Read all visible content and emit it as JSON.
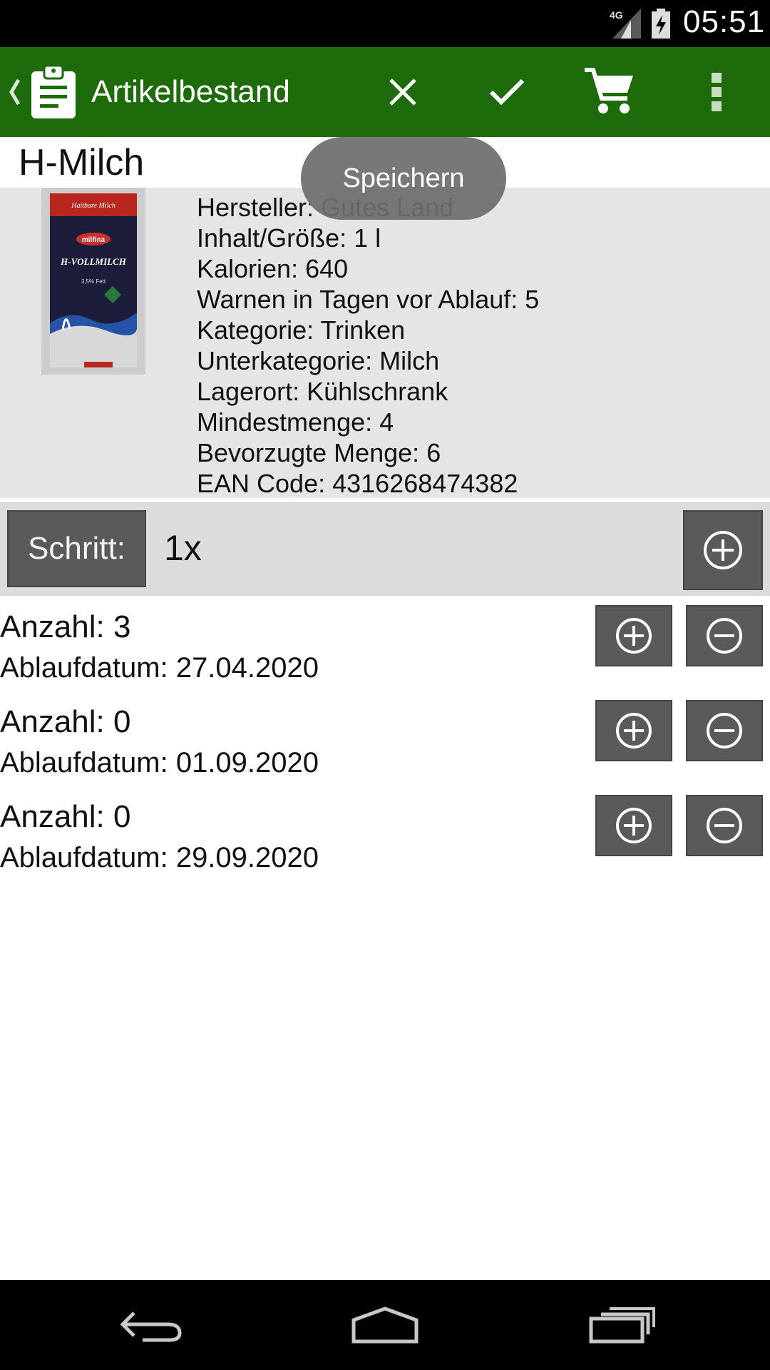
{
  "status_bar": {
    "network_label": "4G",
    "time": "05:51",
    "icons": [
      "signal-4g-icon",
      "battery-charging-icon"
    ]
  },
  "action_bar": {
    "title": "Artikelbestand",
    "background_color": "#1e6b0c",
    "icons": [
      "up-chevron-icon",
      "clipboard-icon",
      "close-icon",
      "check-icon",
      "cart-icon",
      "more-vert-icon"
    ]
  },
  "product": {
    "name": "H-Milch",
    "image_text": {
      "top": "Haltbare Milch",
      "brand": "milfina",
      "name": "H-VOLLMILCH",
      "fat": "3,5% Fett"
    },
    "details": [
      "Hersteller: Gutes Land",
      "Inhalt/Größe: 1 l",
      "Kalorien: 640",
      "Warnen in Tagen vor Ablauf: 5",
      "Kategorie: Trinken",
      "Unterkategorie: Milch",
      "Lagerort: Kühlschrank",
      "Mindestmenge: 4",
      "Bevorzugte Menge: 6",
      "EAN Code: 4316268474382"
    ]
  },
  "toast": {
    "text": "Speichern"
  },
  "step": {
    "label": "Schritt:",
    "value": "1x"
  },
  "stock_items": [
    {
      "count": "Anzahl: 3",
      "expiry": "Ablaufdatum: 27.04.2020"
    },
    {
      "count": "Anzahl: 0",
      "expiry": "Ablaufdatum: 01.09.2020"
    },
    {
      "count": "Anzahl: 0",
      "expiry": "Ablaufdatum: 29.09.2020"
    }
  ],
  "nav_bar": {
    "icons": [
      "back-icon",
      "home-icon",
      "recent-apps-icon"
    ]
  },
  "colors": {
    "button_gray": "#5a5a5a",
    "details_background": "#e5e5e5",
    "step_row_background": "#dcdcdc"
  }
}
